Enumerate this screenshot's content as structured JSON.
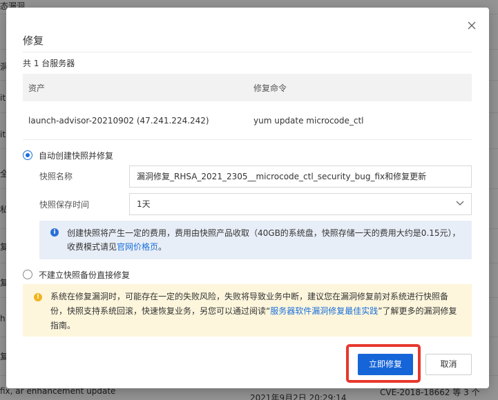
{
  "background": {
    "fragments": [
      "态漏洞",
      "洞",
      "it",
      "it",
      "全",
      "私",
      "复",
      "复",
      "h",
      "复",
      "ix"
    ],
    "bottom_left": "fix, ar enhancement update",
    "bottom_time": "2021年9月2日 20:29:14",
    "bottom_right": "CVE-2018-18662 等 3 个"
  },
  "dialog": {
    "title": "修复",
    "close_icon": "close-icon",
    "server_count": "共 1 台服务器",
    "table": {
      "headers": [
        "资产",
        "修复命令"
      ],
      "rows": [
        [
          "launch-advisor-20210902 (47.241.224.242)",
          "yum update microcode_ctl"
        ]
      ]
    },
    "option_snapshot": {
      "label": "自动创建快照并修复",
      "checked": true,
      "name_label": "快照名称",
      "name_value": "漏洞修复_RHSA_2021_2305__microcode_ctl_security_bug_fix和修复更新",
      "retention_label": "快照保存时间",
      "retention_value": "1天"
    },
    "info": {
      "text_before": "创建快照将产生一定的费用，费用由快照产品收取（40GB的系统盘，快照存储一天的费用大约是0.15元），收费模式请见",
      "link": "官网价格页",
      "text_after": "。"
    },
    "option_no_snapshot": {
      "label": "不建立快照备份直接修复",
      "checked": false
    },
    "warning": {
      "text_before": "系统在修复漏洞时，可能存在一定的失败风险，失败将导致业务中断，建议您在漏洞修复前对系统进行快照备份，快照支持系统回滚，快速恢复业务，另您可以通过阅读“",
      "link": "服务器软件漏洞修复最佳实践",
      "text_after": "”了解更多的漏洞修复指南。"
    },
    "buttons": {
      "confirm": "立即修复",
      "cancel": "取消"
    },
    "colors": {
      "primary": "#1565d8",
      "highlight": "#e8372c",
      "info_bg": "#e8eef7",
      "warning_bg": "#fdf6dd"
    }
  }
}
